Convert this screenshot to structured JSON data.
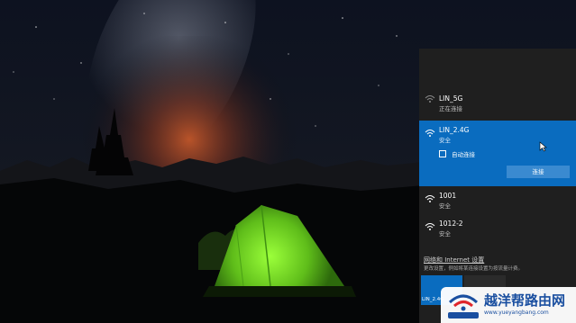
{
  "wallpaper": {
    "description": "starry night sky with milky way, mountains, green tent"
  },
  "network_flyout": {
    "networks": [
      {
        "name": "LIN_5G",
        "status": "正在连接",
        "selected": false
      },
      {
        "name": "LIN_2.4G",
        "status": "安全",
        "selected": true,
        "auto_connect_label": "自动连接",
        "connect_label": "连接"
      },
      {
        "name": "1001",
        "status": "安全",
        "selected": false
      },
      {
        "name": "1012-2",
        "status": "安全",
        "selected": false
      }
    ],
    "settings_link": "网络和 Internet 设置",
    "settings_desc": "更改设置，例如将某连接设置为按流量计费。",
    "quick_tile_label": "LIN_2.4G"
  },
  "watermark": {
    "title": "越洋帮路由网",
    "url": "www.yueyangbang.com"
  },
  "colors": {
    "accent": "#0a6cbf",
    "flyout_bg": "#1f1f1f",
    "tent": "#7ed321"
  }
}
